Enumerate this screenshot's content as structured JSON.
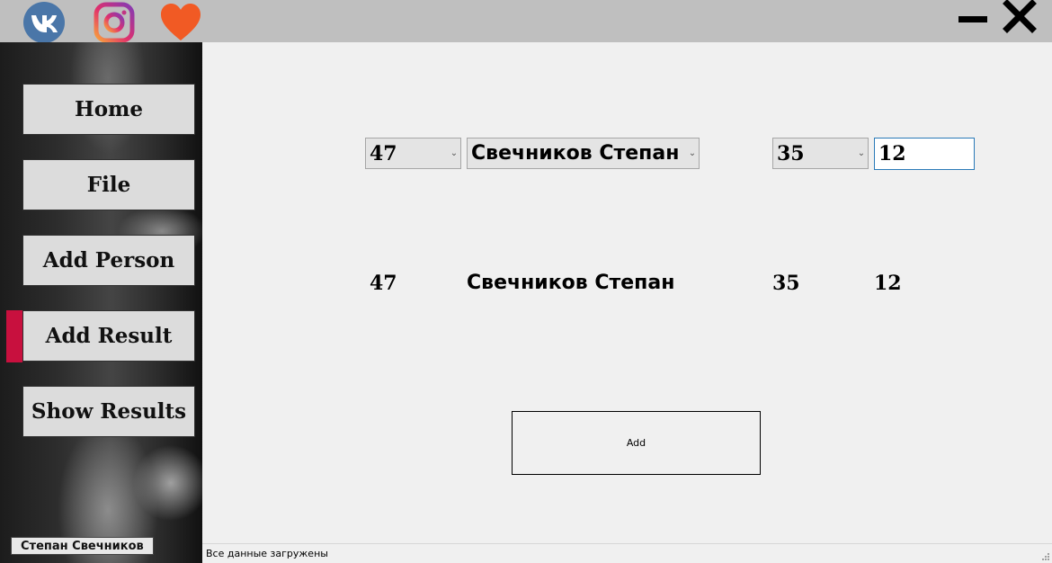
{
  "titlebar": {
    "social_icons": [
      "vk-icon",
      "instagram-icon",
      "heart-icon"
    ]
  },
  "sidebar": {
    "items": [
      {
        "label": "Home"
      },
      {
        "label": "File"
      },
      {
        "label": "Add Person"
      },
      {
        "label": "Add Result"
      },
      {
        "label": "Show Results"
      }
    ],
    "active_index": 3,
    "accent_color": "#c8103e",
    "user_name": "Степан Свечников"
  },
  "form": {
    "combo_number": "47",
    "combo_person": "Свечников Степан",
    "combo_result": "35",
    "text_value": "12"
  },
  "preview": {
    "number": "47",
    "person": "Свечников Степан",
    "result": "35",
    "value": "12"
  },
  "add_button": {
    "label": "Add"
  },
  "statusbar": {
    "text": "Все данные загружены"
  }
}
